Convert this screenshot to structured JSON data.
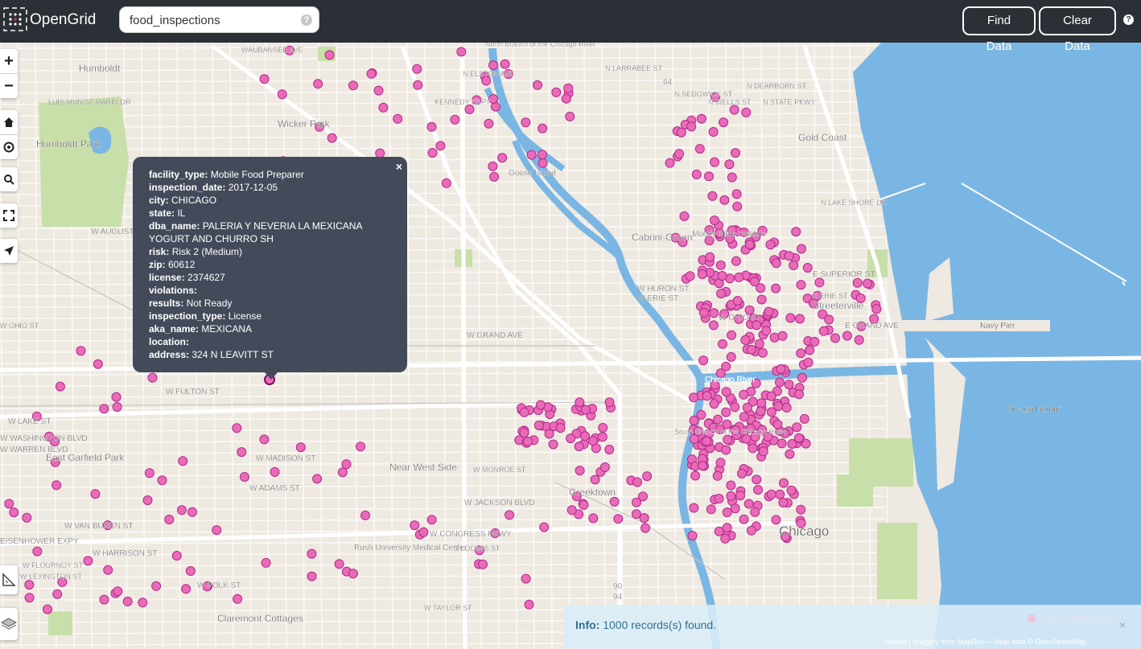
{
  "app": {
    "title": "OpenGrid"
  },
  "search": {
    "value": "food_inspections",
    "help_icon": "question-circle-icon"
  },
  "toolbar": {
    "find_label": "Find Data",
    "clear_label": "Clear Data",
    "help_icon": "question-circle-icon"
  },
  "colors": {
    "topbar": "#2b2f36",
    "marker": "#e96bb8",
    "marker_stroke": "#b3288a",
    "water": "#7ab6e3",
    "park": "#c9dfa9",
    "popup": "#434b5a"
  },
  "map_controls": [
    "zoom-in-icon",
    "zoom-out-icon",
    "home-icon",
    "locate-icon",
    "zoom-box-icon",
    "fullscreen-icon",
    "navigate-icon",
    "measure-icon",
    "layers-icon"
  ],
  "map_controls_text": {
    "zoom_in": "+",
    "zoom_out": "−"
  },
  "map_labels": [
    "Humboldt",
    "LUIS MUNOZ MARIN DR",
    "Humboldt Park",
    "Wicker Park",
    "W AUGUSTA",
    "W OHIO ST",
    "W FULTON ST",
    "W LAKE ST",
    "W WASHINGTON BLVD",
    "W WARREN BLVD",
    "East Garfield Park",
    "W MADISON ST",
    "W ADAMS ST",
    "W VAN BUREN ST",
    "EISENHOWER EXPY",
    "W HARRISON ST",
    "W FLOURNOY ST",
    "W LEXINGTON ST",
    "W POLK ST",
    "Claremont Cottages",
    "W TAYLOR ST",
    "Rush University Medical Center",
    "Near West Side",
    "W MONROE ST",
    "W JACKSON BLVD",
    "W CONGRESS PKWY",
    "Greektown",
    "W GRAND AVE",
    "W HURON ST",
    "W ERIE ST",
    "W OHIO ST",
    "Cabrini-Green",
    "Moody Bible Institute",
    "Goose Island",
    "Gold Coast",
    "N LAKE SHORE DR",
    "E SUPERIOR ST",
    "E ERIE ST",
    "Streeterville",
    "E GRAND AVE",
    "Navy Pier",
    "Chicago River",
    "Chicago Harbor",
    "Chicago",
    "KENNEDY EXPY",
    "N ELSTON AVE",
    "N LARRABEE ST",
    "N SEDGWICK ST",
    "N WELLS ST",
    "N DEARBORN ST",
    "N STATE PKWY",
    "S LOOMIS ST",
    "WAUBANSEE AVE",
    "North Branch of the Chicago River",
    "South Branch of the Chicago River",
    "90",
    "94",
    "64"
  ],
  "popup": {
    "close": "×",
    "rows": [
      {
        "key": "facility_type:",
        "value": "Mobile Food Preparer"
      },
      {
        "key": "inspection_date:",
        "value": "2017-12-05"
      },
      {
        "key": "city:",
        "value": "CHICAGO"
      },
      {
        "key": "state:",
        "value": "IL"
      },
      {
        "key": "dba_name:",
        "value": "PALERIA Y NEVERIA LA MEXICANA YOGURT AND CHURRO SH"
      },
      {
        "key": "risk:",
        "value": "Risk 2 (Medium)"
      },
      {
        "key": "zip:",
        "value": "60612"
      },
      {
        "key": "license:",
        "value": "2374627"
      },
      {
        "key": "violations:",
        "value": ""
      },
      {
        "key": "results:",
        "value": "Not Ready"
      },
      {
        "key": "inspection_type:",
        "value": "License"
      },
      {
        "key": "aka_name:",
        "value": "MEXICANA"
      },
      {
        "key": "location:",
        "value": ""
      },
      {
        "key": "address:",
        "value": "324 N LEAVITT ST"
      }
    ]
  },
  "info": {
    "label": "Info:",
    "message": "1000 records(s) found.",
    "close": "×"
  },
  "legend": {
    "label": "Food Inspections"
  },
  "attribution": "Leaflet | Imagery from MapBox — Map data © OpenStreetMap"
}
